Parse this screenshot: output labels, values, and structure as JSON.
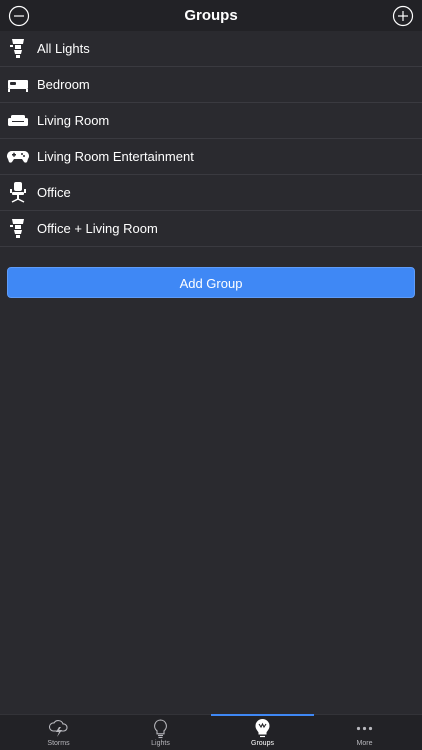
{
  "header": {
    "title": "Groups"
  },
  "groups": [
    {
      "label": "All Lights",
      "icon": "lamps-icon"
    },
    {
      "label": "Bedroom",
      "icon": "bed-icon"
    },
    {
      "label": "Living Room",
      "icon": "sofa-icon"
    },
    {
      "label": "Living Room Entertainment",
      "icon": "gamepad-icon"
    },
    {
      "label": "Office",
      "icon": "office-chair-icon"
    },
    {
      "label": "Office + Living Room",
      "icon": "lamps-icon"
    }
  ],
  "add_group_label": "Add Group",
  "tabs": [
    {
      "label": "Storms",
      "icon": "storm-cloud-icon"
    },
    {
      "label": "Lights",
      "icon": "bulb-icon"
    },
    {
      "label": "Groups",
      "icon": "group-bulb-icon",
      "active": true
    },
    {
      "label": "More",
      "icon": "more-dots-icon"
    }
  ],
  "colors": {
    "background": "#2a2a2f",
    "bar": "#222226",
    "accent": "#3f88f5",
    "text": "#ffffff",
    "tab_inactive": "#b8b8bd"
  }
}
